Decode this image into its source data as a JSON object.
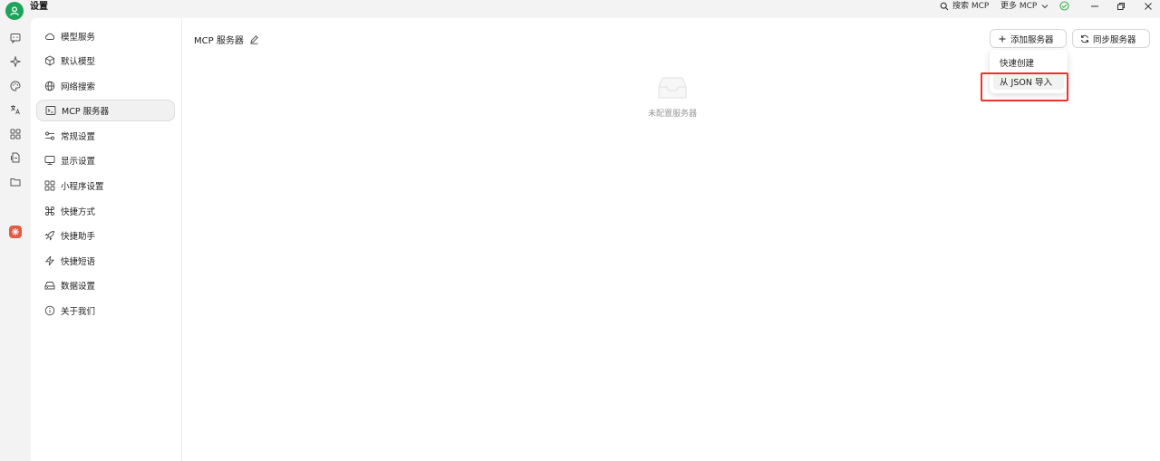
{
  "titlebar": {
    "app_title": "设置",
    "search_label": "搜索 MCP",
    "more_label": "更多 MCP"
  },
  "rail": {
    "icons": [
      "chat-icon",
      "sparkle-icon",
      "palette-icon",
      "translate-icon",
      "apps-icon",
      "document-icon",
      "folder-icon",
      "mini-app-icon"
    ]
  },
  "sidebar": {
    "items": [
      {
        "label": "模型服务",
        "icon": "cloud-icon"
      },
      {
        "label": "默认模型",
        "icon": "cube-icon"
      },
      {
        "label": "网络搜索",
        "icon": "globe-icon"
      },
      {
        "label": "MCP 服务器",
        "icon": "terminal-icon",
        "active": true
      },
      {
        "label": "常规设置",
        "icon": "settings-sliders-icon"
      },
      {
        "label": "显示设置",
        "icon": "monitor-icon"
      },
      {
        "label": "小程序设置",
        "icon": "grid-icon"
      },
      {
        "label": "快捷方式",
        "icon": "command-icon"
      },
      {
        "label": "快捷助手",
        "icon": "rocket-icon"
      },
      {
        "label": "快捷短语",
        "icon": "zap-icon"
      },
      {
        "label": "数据设置",
        "icon": "drive-icon"
      },
      {
        "label": "关于我们",
        "icon": "info-icon"
      }
    ]
  },
  "main": {
    "title": "MCP 服务器",
    "add_button": "添加服务器",
    "sync_button": "同步服务器",
    "empty_text": "未配置服务器"
  },
  "dropdown": {
    "items": [
      "快速创建",
      "从 JSON 导入"
    ]
  },
  "colors": {
    "avatar": "#1ea45a",
    "status_ok": "#3bb54a",
    "highlight": "#e8352d",
    "app_badge": "#e25b45"
  }
}
